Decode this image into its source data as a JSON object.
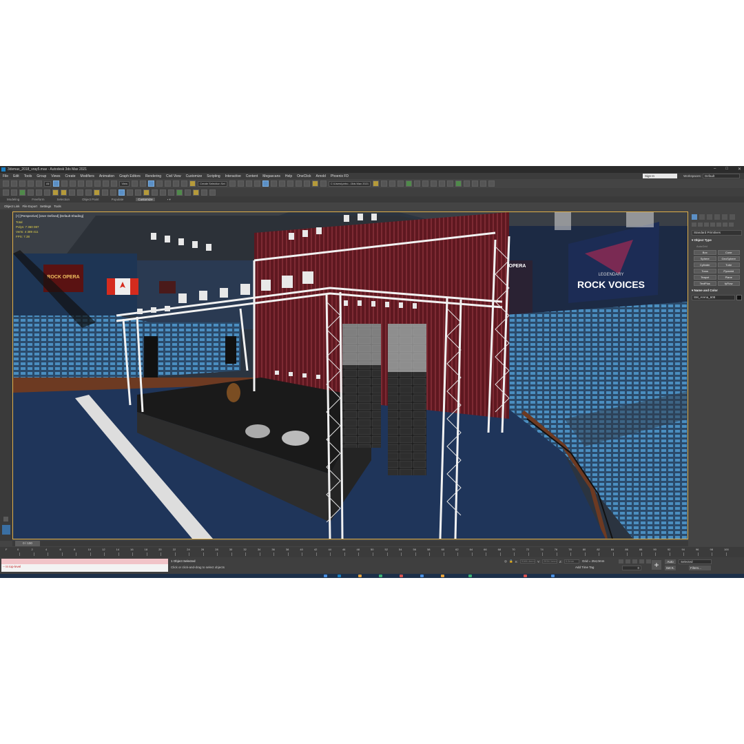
{
  "window": {
    "title": "3dsmax_2018_vray5.max - Autodesk 3ds Max 2021",
    "controls": [
      "–",
      "□",
      "✕"
    ]
  },
  "menu": [
    "File",
    "Edit",
    "Tools",
    "Group",
    "Views",
    "Create",
    "Modifiers",
    "Animation",
    "Graph Editors",
    "Rendering",
    "Civil View",
    "Customize",
    "Scripting",
    "Interactive",
    "Content",
    "Megascans",
    "Help",
    "OneClick",
    "Arnold",
    "Phoenix FD"
  ],
  "account": {
    "signin": "Sign In",
    "workspaces_label": "Workspaces:",
    "workspace": "Default"
  },
  "toolbar": {
    "filter": "All",
    "ref_coord": "View",
    "selection_set": "Create Selection Set",
    "project_path": "C:\\Users\\petro...\\3ds Max 2021"
  },
  "ribbon_tabs": [
    "Modeling",
    "Freeform",
    "Selection",
    "Object Paint",
    "Populate",
    "Customize"
  ],
  "ribbon_active": "Customize",
  "scene_explorer_tabs": [
    "Object Link",
    "File Export",
    "Settings",
    "Tools"
  ],
  "viewport": {
    "label": "[+] [Perspective] [User Defined] [Default Shading]",
    "stats": [
      "Total",
      "Polys: 7 360 087",
      "Verts: 4 389 411",
      "FPS: 7.38"
    ],
    "scene": {
      "left_poster": "ROCK OPERA",
      "mid_poster": "OPERA",
      "right_poster_top": "LEGENDARY",
      "right_poster_main": "ROCK VOICES",
      "stage_color": "#1a1a1a",
      "curtain_color": "#6b1d24",
      "seat_color": "#3f7fb0",
      "floor_color": "#1f355a"
    }
  },
  "command_panel": {
    "category": "Standard Primitives",
    "object_type_title": "Object Type",
    "autogrid": "AutoGrid",
    "primitives": [
      "Box",
      "Cone",
      "Sphere",
      "GeoSphere",
      "Cylinder",
      "Tube",
      "Torus",
      "Pyramid",
      "Teapot",
      "Plane",
      "TextPlus",
      "fyFlow"
    ],
    "name_color_title": "Name and Color",
    "object_name": "SM_Arena_608",
    "object_color": "#111111"
  },
  "timeline": {
    "frame_readout": "0 / 100",
    "ticks": [
      "0",
      "2",
      "4",
      "6",
      "8",
      "10",
      "12",
      "14",
      "16",
      "18",
      "20",
      "22",
      "24",
      "26",
      "28",
      "30",
      "32",
      "34",
      "36",
      "38",
      "40",
      "42",
      "44",
      "46",
      "48",
      "50",
      "52",
      "54",
      "56",
      "58",
      "60",
      "62",
      "64",
      "66",
      "68",
      "70",
      "72",
      "74",
      "76",
      "78",
      "80",
      "82",
      "84",
      "86",
      "88",
      "90",
      "92",
      "94",
      "96",
      "98",
      "100"
    ]
  },
  "status": {
    "maxscript_output": "-- In top-level",
    "selected": "1 Object Selected",
    "prompt": "Click or click-and-drag to select objects",
    "x_label": "X:",
    "y_label": "Y:",
    "z_label": "Z:",
    "x_value": "5166.4mm",
    "y_value": "2034.1mm",
    "z_value": "0.0mm",
    "grid": "Grid = 254,0mm",
    "add_time_tag": "Add Time Tag",
    "auto_key": "Auto",
    "set_key": "Set K.",
    "key_mode": "Selected",
    "filters": "Filters...",
    "current_frame": "0"
  }
}
